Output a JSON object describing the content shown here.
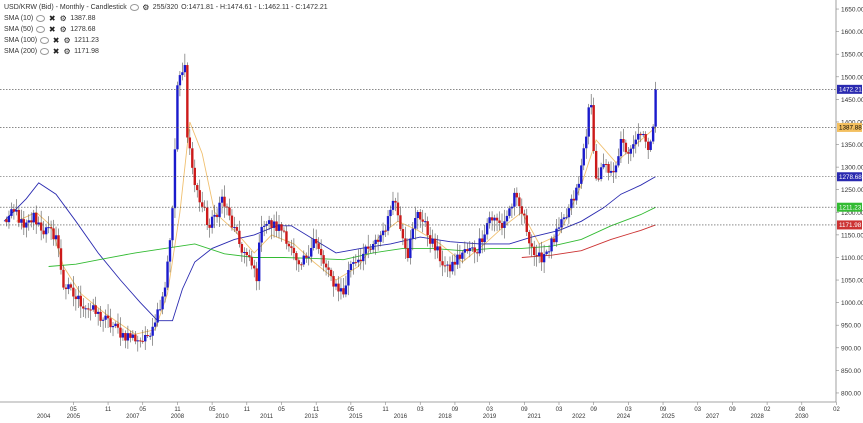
{
  "header": {
    "title": "USD/KRW (Bid) - Monthly - Candlestick",
    "counter": "255/320",
    "ohlc": "O:1471.81 - H:1474.61 - L:1462.11 - C:1472.21"
  },
  "legend": [
    {
      "label": "SMA (10)",
      "value": "1387.88",
      "color": "#e8b040"
    },
    {
      "label": "SMA (50)",
      "value": "1278.68",
      "color": "#2a2ab0"
    },
    {
      "label": "SMA (100)",
      "value": "1211.23",
      "color": "#33bb33"
    },
    {
      "label": "SMA (200)",
      "value": "1171.98",
      "color": "#cc3333"
    }
  ],
  "chart_data": {
    "type": "candlestick",
    "title": "USD/KRW (Bid) - Monthly - Candlestick",
    "y_ticks": [
      "800.00",
      "850.00",
      "900.00",
      "950.00",
      "1000.00",
      "1050.00",
      "1100.00",
      "1150.00",
      "1200.00",
      "1250.00",
      "1300.00",
      "1350.00",
      "1400.00",
      "1450.00",
      "1500.00",
      "1550.00",
      "1600.00",
      "1650.00"
    ],
    "ylim": [
      780,
      1670
    ],
    "x_tick_months": [
      "05",
      "11",
      "05",
      "11",
      "05",
      "11",
      "05",
      "11",
      "05",
      "11",
      "03",
      "09",
      "03",
      "09",
      "03",
      "09",
      "03",
      "09",
      "03",
      "09",
      "02",
      "08",
      "02",
      "08",
      "02"
    ],
    "x_tick_years": [
      "2004",
      "2005",
      "2007",
      "2008",
      "2010",
      "2011",
      "2013",
      "2015",
      "2016",
      "2018",
      "2019",
      "2021",
      "2022",
      "2024",
      "2025",
      "2027",
      "2028",
      "2030"
    ],
    "date_range": [
      "2003-01",
      "2030-12"
    ],
    "price_markers": [
      {
        "label": "1472.21",
        "value": 1472.21,
        "bg": "#2a2ab0",
        "fg": "#ffffff"
      },
      {
        "label": "1387.88",
        "value": 1387.88,
        "bg": "#f4c060",
        "fg": "#000000"
      },
      {
        "label": "1278.68",
        "value": 1278.68,
        "bg": "#2a2ab0",
        "fg": "#ffffff"
      },
      {
        "label": "1211.23",
        "value": 1211.23,
        "bg": "#33bb33",
        "fg": "#ffffff"
      },
      {
        "label": "1171.98",
        "value": 1171.98,
        "bg": "#cc3333",
        "fg": "#ffffff"
      }
    ],
    "anchors": [
      [
        "2003-01",
        1180
      ],
      [
        "2003-06",
        1200
      ],
      [
        "2003-09",
        1160
      ],
      [
        "2004-01",
        1190
      ],
      [
        "2004-05",
        1160
      ],
      [
        "2004-10",
        1150
      ],
      [
        "2005-01",
        1040
      ],
      [
        "2005-06",
        1010
      ],
      [
        "2006-01",
        980
      ],
      [
        "2006-06",
        960
      ],
      [
        "2007-01",
        930
      ],
      [
        "2007-10",
        915
      ],
      [
        "2008-03",
        980
      ],
      [
        "2008-06",
        1040
      ],
      [
        "2008-09",
        1200
      ],
      [
        "2008-11",
        1480
      ],
      [
        "2009-02",
        1520
      ],
      [
        "2009-03",
        1380
      ],
      [
        "2009-06",
        1260
      ],
      [
        "2009-12",
        1165
      ],
      [
        "2010-05",
        1230
      ],
      [
        "2010-12",
        1130
      ],
      [
        "2011-07",
        1060
      ],
      [
        "2011-09",
        1180
      ],
      [
        "2012-06",
        1160
      ],
      [
        "2012-12",
        1070
      ],
      [
        "2013-06",
        1140
      ],
      [
        "2013-12",
        1060
      ],
      [
        "2014-06",
        1020
      ],
      [
        "2014-09",
        1090
      ],
      [
        "2015-06",
        1120
      ],
      [
        "2015-12",
        1180
      ],
      [
        "2016-02",
        1240
      ],
      [
        "2016-08",
        1110
      ],
      [
        "2016-12",
        1205
      ],
      [
        "2017-06",
        1130
      ],
      [
        "2017-12",
        1070
      ],
      [
        "2018-06",
        1110
      ],
      [
        "2018-12",
        1120
      ],
      [
        "2019-05",
        1190
      ],
      [
        "2019-10",
        1170
      ],
      [
        "2020-03",
        1230
      ],
      [
        "2020-06",
        1200
      ],
      [
        "2020-12",
        1090
      ],
      [
        "2021-06",
        1130
      ],
      [
        "2021-12",
        1190
      ],
      [
        "2022-05",
        1260
      ],
      [
        "2022-09",
        1420
      ],
      [
        "2022-10",
        1430
      ],
      [
        "2022-12",
        1270
      ],
      [
        "2023-03",
        1300
      ],
      [
        "2023-06",
        1280
      ],
      [
        "2023-10",
        1350
      ],
      [
        "2024-02",
        1330
      ],
      [
        "2024-06",
        1380
      ],
      [
        "2024-09",
        1330
      ],
      [
        "2024-11",
        1400
      ],
      [
        "2024-12",
        1472
      ]
    ],
    "sma": [
      {
        "name": "SMA (10)",
        "color": "#f0c070",
        "points": [
          [
            "2003-06",
            1180
          ],
          [
            "2004-02",
            1200
          ],
          [
            "2004-08",
            1170
          ],
          [
            "2005-01",
            1080
          ],
          [
            "2005-08",
            1020
          ],
          [
            "2006-06",
            975
          ],
          [
            "2007-06",
            930
          ],
          [
            "2008-02",
            940
          ],
          [
            "2008-07",
            1020
          ],
          [
            "2008-12",
            1200
          ],
          [
            "2009-04",
            1400
          ],
          [
            "2009-09",
            1330
          ],
          [
            "2010-02",
            1200
          ],
          [
            "2010-10",
            1160
          ],
          [
            "2011-06",
            1110
          ],
          [
            "2012-01",
            1150
          ],
          [
            "2012-10",
            1130
          ],
          [
            "2013-06",
            1090
          ],
          [
            "2014-03",
            1050
          ],
          [
            "2014-12",
            1080
          ],
          [
            "2015-09",
            1150
          ],
          [
            "2016-04",
            1180
          ],
          [
            "2016-12",
            1160
          ],
          [
            "2017-09",
            1130
          ],
          [
            "2018-06",
            1090
          ],
          [
            "2019-03",
            1130
          ],
          [
            "2019-11",
            1170
          ],
          [
            "2020-06",
            1200
          ],
          [
            "2021-01",
            1130
          ],
          [
            "2021-09",
            1150
          ],
          [
            "2022-06",
            1260
          ],
          [
            "2022-12",
            1360
          ],
          [
            "2023-08",
            1310
          ],
          [
            "2024-04",
            1350
          ],
          [
            "2024-12",
            1388
          ]
        ]
      },
      {
        "name": "SMA (50)",
        "color": "#2a2ab0",
        "points": [
          [
            "2003-01",
            1180
          ],
          [
            "2003-10",
            1230
          ],
          [
            "2004-03",
            1265
          ],
          [
            "2004-10",
            1240
          ],
          [
            "2005-06",
            1180
          ],
          [
            "2006-03",
            1110
          ],
          [
            "2006-12",
            1050
          ],
          [
            "2007-08",
            1000
          ],
          [
            "2008-03",
            960
          ],
          [
            "2008-09",
            960
          ],
          [
            "2009-01",
            1030
          ],
          [
            "2009-06",
            1090
          ],
          [
            "2010-01",
            1120
          ],
          [
            "2010-10",
            1140
          ],
          [
            "2011-06",
            1150
          ],
          [
            "2012-03",
            1170
          ],
          [
            "2012-09",
            1170
          ],
          [
            "2013-06",
            1140
          ],
          [
            "2014-03",
            1110
          ],
          [
            "2015-01",
            1120
          ],
          [
            "2016-01",
            1130
          ],
          [
            "2017-01",
            1145
          ],
          [
            "2018-01",
            1135
          ],
          [
            "2019-01",
            1130
          ],
          [
            "2020-01",
            1130
          ],
          [
            "2020-10",
            1145
          ],
          [
            "2021-09",
            1160
          ],
          [
            "2022-06",
            1180
          ],
          [
            "2023-03",
            1210
          ],
          [
            "2023-10",
            1240
          ],
          [
            "2024-06",
            1260
          ],
          [
            "2024-12",
            1279
          ]
        ]
      },
      {
        "name": "SMA (100)",
        "color": "#33bb33",
        "points": [
          [
            "2004-07",
            1080
          ],
          [
            "2005-06",
            1085
          ],
          [
            "2006-06",
            1098
          ],
          [
            "2007-06",
            1110
          ],
          [
            "2008-06",
            1120
          ],
          [
            "2009-06",
            1130
          ],
          [
            "2010-06",
            1108
          ],
          [
            "2011-06",
            1100
          ],
          [
            "2012-06",
            1100
          ],
          [
            "2013-06",
            1098
          ],
          [
            "2014-06",
            1095
          ],
          [
            "2015-06",
            1110
          ],
          [
            "2016-06",
            1120
          ],
          [
            "2017-06",
            1120
          ],
          [
            "2018-06",
            1115
          ],
          [
            "2019-06",
            1120
          ],
          [
            "2020-06",
            1120
          ],
          [
            "2021-06",
            1125
          ],
          [
            "2022-06",
            1140
          ],
          [
            "2023-06",
            1170
          ],
          [
            "2024-06",
            1195
          ],
          [
            "2024-12",
            1211
          ]
        ]
      },
      {
        "name": "SMA (200)",
        "color": "#cc3333",
        "points": [
          [
            "2020-06",
            1100
          ],
          [
            "2021-06",
            1105
          ],
          [
            "2022-06",
            1115
          ],
          [
            "2023-06",
            1140
          ],
          [
            "2024-06",
            1160
          ],
          [
            "2024-12",
            1172
          ]
        ]
      }
    ]
  }
}
